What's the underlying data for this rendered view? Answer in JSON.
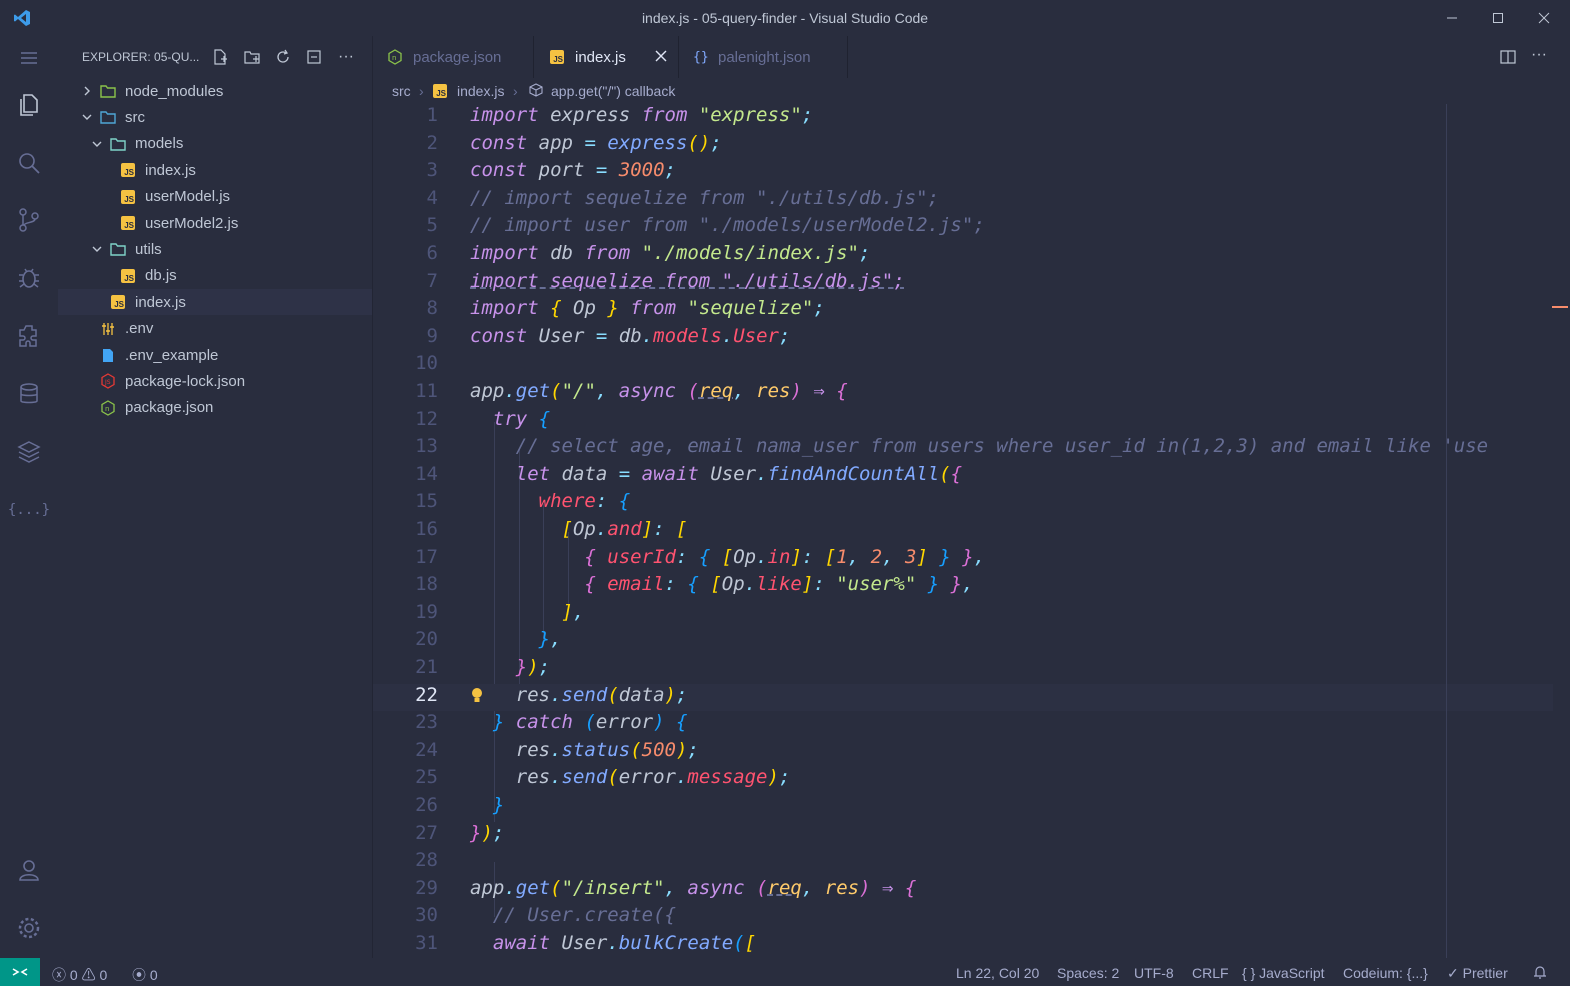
{
  "window": {
    "title": "index.js - 05-query-finder - Visual Studio Code"
  },
  "sidebar": {
    "title": "EXPLORER: 05-QU...",
    "tree": [
      {
        "label": "node_modules",
        "kind": "folder",
        "expanded": false,
        "depth": 0
      },
      {
        "label": "src",
        "kind": "folder",
        "expanded": true,
        "depth": 0
      },
      {
        "label": "models",
        "kind": "folder",
        "expanded": true,
        "depth": 1
      },
      {
        "label": "index.js",
        "kind": "js",
        "depth": 2
      },
      {
        "label": "userModel.js",
        "kind": "js",
        "depth": 2
      },
      {
        "label": "userModel2.js",
        "kind": "js",
        "depth": 2
      },
      {
        "label": "utils",
        "kind": "folder",
        "expanded": true,
        "depth": 1
      },
      {
        "label": "db.js",
        "kind": "js",
        "depth": 2
      },
      {
        "label": "index.js",
        "kind": "js",
        "depth": 1,
        "selected": true
      },
      {
        "label": ".env",
        "kind": "env",
        "depth": 0
      },
      {
        "label": ".env_example",
        "kind": "file",
        "depth": 0
      },
      {
        "label": "package-lock.json",
        "kind": "npm",
        "depth": 0
      },
      {
        "label": "package.json",
        "kind": "node",
        "depth": 0
      }
    ]
  },
  "tabs": [
    {
      "label": "package.json",
      "active": false
    },
    {
      "label": "index.js",
      "active": true
    },
    {
      "label": "palenight.json",
      "active": false
    }
  ],
  "breadcrumb": {
    "folder": "src",
    "file": "index.js",
    "symbol": "app.get(\"/\") callback"
  },
  "editor": {
    "current_line": 22,
    "lines": [
      "1",
      "2",
      "3",
      "4",
      "5",
      "6",
      "7",
      "8",
      "9",
      "10",
      "11",
      "12",
      "13",
      "14",
      "15",
      "16",
      "17",
      "18",
      "19",
      "20",
      "21",
      "22",
      "23",
      "24",
      "25",
      "26",
      "27",
      "28",
      "29",
      "30",
      "31"
    ]
  },
  "statusbar": {
    "errors": "0",
    "warnings": "0",
    "ports": "0",
    "position": "Ln 22, Col 20",
    "spaces": "Spaces: 2",
    "encoding": "UTF-8",
    "eol": "CRLF",
    "language": "JavaScript",
    "codeium": "Codeium: {...}",
    "prettier": "Prettier"
  },
  "colors": {
    "background": "#292d3e",
    "remote": "#009688",
    "accent_js": "#f5c242"
  }
}
